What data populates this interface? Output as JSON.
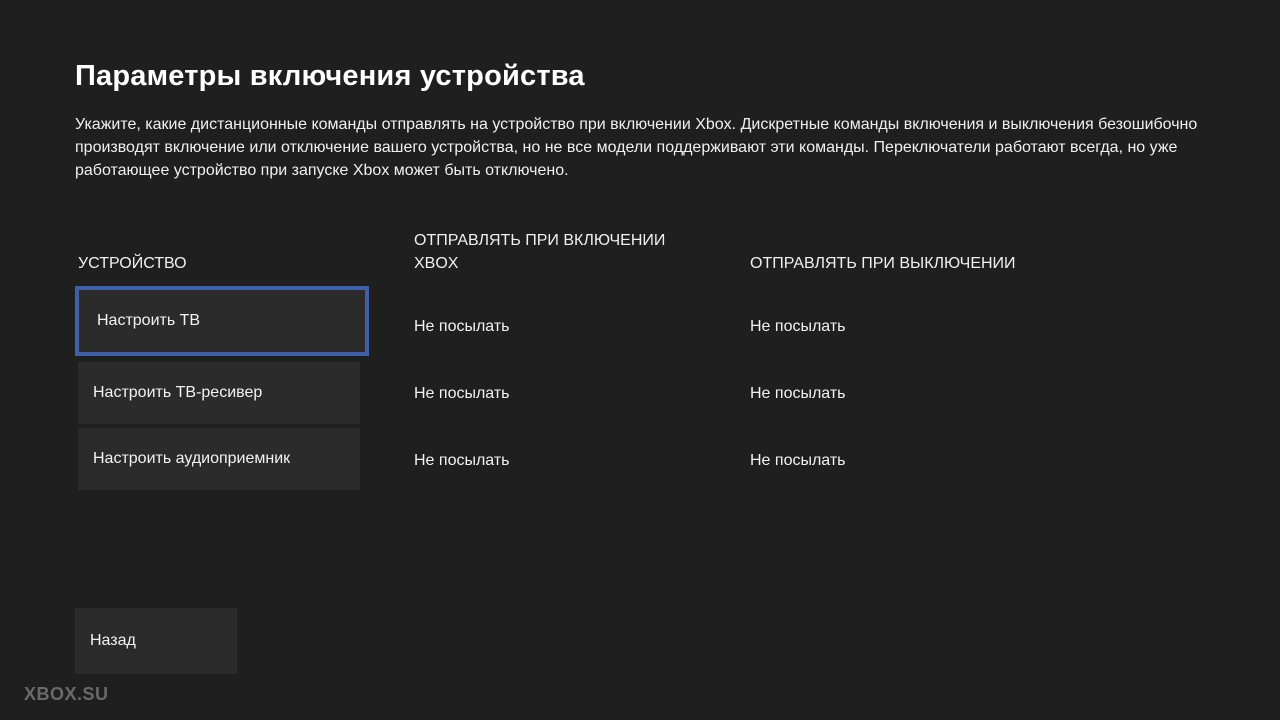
{
  "page": {
    "title": "Параметры включения устройства",
    "description": "Укажите, какие дистанционные команды отправлять на устройство при включении Xbox. Дискретные команды включения и выключения безошибочно производят включение или отключение вашего устройства, но не все модели поддерживают эти команды. Переключатели работают всегда, но уже работающее устройство при запуске Xbox может быть отключено."
  },
  "table": {
    "headers": {
      "device": "УСТРОЙСТВО",
      "on": "ОТПРАВЛЯТЬ ПРИ ВКЛЮЧЕНИИ XBOX",
      "off": "ОТПРАВЛЯТЬ ПРИ ВЫКЛЮЧЕНИИ"
    },
    "rows": [
      {
        "device": "Настроить ТВ",
        "on": "Не посылать",
        "off": "Не посылать",
        "focused": true
      },
      {
        "device": "Настроить ТВ-ресивер",
        "on": "Не посылать",
        "off": "Не посылать",
        "focused": false
      },
      {
        "device": "Настроить аудиоприемник",
        "on": "Не посылать",
        "off": "Не посылать",
        "focused": false
      }
    ]
  },
  "footer": {
    "back_label": "Назад"
  },
  "watermark": "XBOX.SU",
  "colors": {
    "background": "#1f1f1f",
    "button": "#2b2b2b",
    "focus": "#3f5fa8"
  }
}
